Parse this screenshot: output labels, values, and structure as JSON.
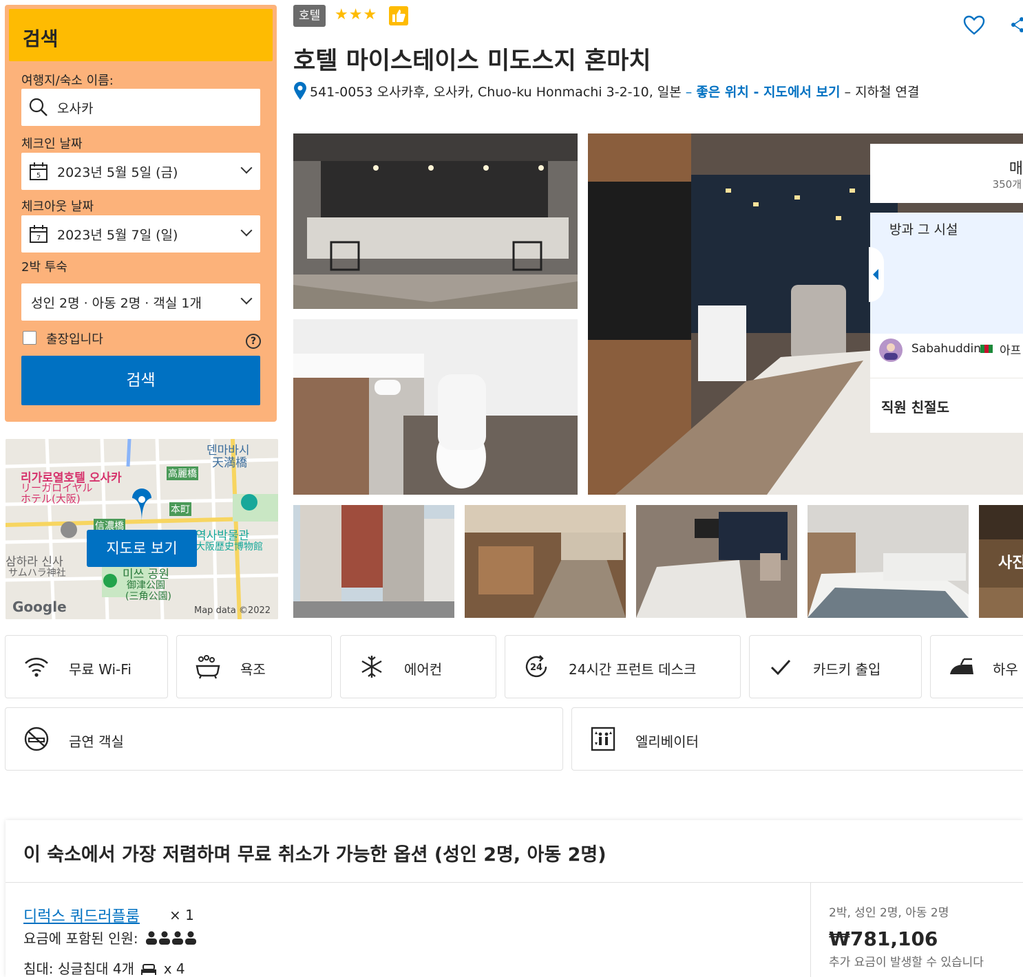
{
  "search": {
    "title": "검색",
    "destination_label": "여행지/숙소 이름:",
    "destination_value": "오사카",
    "checkin_label": "체크인 날짜",
    "checkin_value": "2023년 5월 5일 (금)",
    "checkin_day": "5",
    "checkout_label": "체크아웃 날짜",
    "checkout_value": "2023년 5월 7일 (일)",
    "checkout_day": "7",
    "nights": "2박 투숙",
    "guests_value": "성인 2명 · 아동 2명 · 객실 1개",
    "business_label": "출장입니다",
    "help": "?",
    "button": "검색"
  },
  "map": {
    "button": "지도로 보기",
    "labels": [
      "덴마바시",
      "天満橋",
      "리가로열호텔 오사카",
      "リーガロイヤル",
      "ホテル(大阪)",
      "高麗橋",
      "本町",
      "信濃橋",
      "역사박물관",
      "大阪歴史博物館",
      "삼하라 신사",
      "サムハラ神社",
      "미쓰 공원",
      "御津公園",
      "(三角公園)"
    ],
    "google": "Google",
    "attribution": "Map data ©2022"
  },
  "hotel": {
    "type": "호텔",
    "stars": "★★★",
    "name": "호텔 마이스테이스 미도스지 혼마치",
    "address": "541-0053 오사카후, 오사카, Chuo-ku Honmachi 3-2-10, 일본",
    "address_sep": "–",
    "location_link": "좋은 위치 - 지도에서 보기",
    "address_suffix": "– 지하철 연결"
  },
  "review_card": {
    "score_word": "매",
    "review_count": "350개",
    "section": "방과 그 시설",
    "reviewer": "Sabahuddin",
    "reviewer_country": "아프",
    "category": "직원 친절도"
  },
  "gallery": {
    "more_label": "사진"
  },
  "facilities": [
    {
      "label": "무료 Wi-Fi",
      "icon": "wifi-icon"
    },
    {
      "label": "욕조",
      "icon": "bathtub-icon"
    },
    {
      "label": "에어컨",
      "icon": "snowflake-icon"
    },
    {
      "label": "24시간 프런트 데스크",
      "icon": "clock-24-icon"
    },
    {
      "label": "카드키 출입",
      "icon": "checkmark-icon"
    },
    {
      "label": "하우",
      "icon": "iron-icon"
    },
    {
      "label": "금연 객실",
      "icon": "no-smoking-icon"
    },
    {
      "label": "엘리베이터",
      "icon": "elevator-icon"
    }
  ],
  "offer": {
    "title": "이 숙소에서 가장 저렴하며 무료 취소가 가능한 옵션 (성인 2명, 아동 2명)",
    "room_name": "디럭스 쿼드러플룸",
    "room_qty": "× 1",
    "occupancy_label": "요금에 포함된 인원:",
    "beds": "침대: 싱글침대 4개",
    "beds_qty": "x 4",
    "price_meta": "2박, 성인 2명, 아동 2명",
    "price": "₩781,106",
    "price_note": "추가 요금이 발생할 수 있습니다"
  },
  "colors": {
    "accent": "#0071c2",
    "search_panel": "#febb02",
    "stars": "#febb02"
  }
}
